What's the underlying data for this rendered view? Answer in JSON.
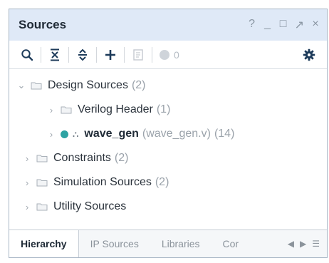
{
  "panel": {
    "title": "Sources",
    "window_buttons": [
      "?",
      "_",
      "□",
      "↗",
      "×"
    ]
  },
  "toolbar": {
    "buttons": [
      "search-icon",
      "collapse-all-icon",
      "expand-all-icon",
      "add-icon",
      "properties-icon"
    ],
    "status_count": "0",
    "settings_icon": "gear-icon"
  },
  "tree": {
    "design_sources": {
      "label": "Design Sources",
      "count": "(2)"
    },
    "verilog_header": {
      "label": "Verilog Header",
      "count": "(1)"
    },
    "wave_gen": {
      "label": "wave_gen",
      "file": "(wave_gen.v)",
      "count": "(14)"
    },
    "constraints": {
      "label": "Constraints",
      "count": "(2)"
    },
    "simulation_sources": {
      "label": "Simulation Sources",
      "count": "(2)"
    },
    "utility_sources": {
      "label": "Utility Sources",
      "count": ""
    }
  },
  "tabs": {
    "items": [
      "Hierarchy",
      "IP Sources",
      "Libraries",
      "Cor"
    ],
    "active": "Hierarchy"
  },
  "colors": {
    "title_bar": "#dfe9f7",
    "status_dot": "#2ea3a3",
    "border": "#a9b7c6"
  }
}
